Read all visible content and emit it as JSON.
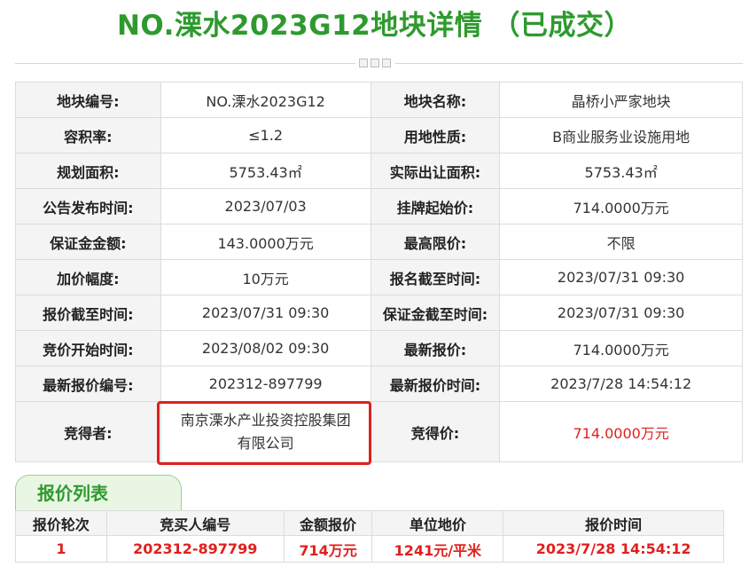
{
  "page": {
    "title": "NO.溧水2023G12地块详情 （已成交）"
  },
  "info": {
    "rows": [
      [
        {
          "label": "地块编号:",
          "value": "NO.溧水2023G12"
        },
        {
          "label": "地块名称:",
          "value": "晶桥小严家地块"
        }
      ],
      [
        {
          "label": "容积率:",
          "value": "≤1.2"
        },
        {
          "label": "用地性质:",
          "value": "B商业服务业设施用地"
        }
      ],
      [
        {
          "label": "规划面积:",
          "value": "5753.43㎡"
        },
        {
          "label": "实际出让面积:",
          "value": "5753.43㎡"
        }
      ],
      [
        {
          "label": "公告发布时间:",
          "value": "2023/07/03"
        },
        {
          "label": "挂牌起始价:",
          "value": "714.0000万元"
        }
      ],
      [
        {
          "label": "保证金金额:",
          "value": "143.0000万元"
        },
        {
          "label": "最高限价:",
          "value": "不限"
        }
      ],
      [
        {
          "label": "加价幅度:",
          "value": "10万元"
        },
        {
          "label": "报名截至时间:",
          "value": "2023/07/31 09:30"
        }
      ],
      [
        {
          "label": "报价截至时间:",
          "value": "2023/07/31 09:30"
        },
        {
          "label": "保证金截至时间:",
          "value": "2023/07/31 09:30"
        }
      ],
      [
        {
          "label": "竞价开始时间:",
          "value": "2023/08/02 09:30"
        },
        {
          "label": "最新报价:",
          "value": "714.0000万元"
        }
      ],
      [
        {
          "label": "最新报价编号:",
          "value": "202312-897799"
        },
        {
          "label": "最新报价时间:",
          "value": "2023/7/28 14:54:12"
        }
      ]
    ],
    "winner_label": "竞得者:",
    "winner_value_line1": "南京溧水产业投资控股集团",
    "winner_value_line2": "有限公司",
    "price_label": "竞得价:",
    "price_value": "714.0000万元"
  },
  "bids": {
    "tab_label": "报价列表",
    "headers": [
      "报价轮次",
      "竞买人编号",
      "金额报价",
      "单位地价",
      "报价时间"
    ],
    "rows": [
      [
        "1",
        "202312-897799",
        "714万元",
        "1241元/平米",
        "2023/7/28 14:54:12"
      ]
    ]
  },
  "colors": {
    "accent_green": "#2e9a2e",
    "highlight_red": "#e0201e"
  }
}
